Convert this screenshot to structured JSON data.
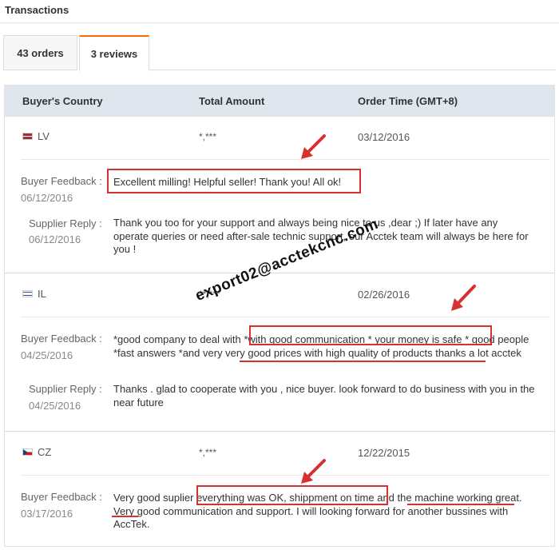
{
  "section_title": "Transactions",
  "tabs": [
    {
      "label": "43 orders"
    },
    {
      "label": "3 reviews"
    }
  ],
  "columns": {
    "country": "Buyer's Country",
    "amount": "Total Amount",
    "time": "Order Time (GMT+8)"
  },
  "labels": {
    "buyer_feedback": "Buyer Feedback :",
    "supplier_reply": "Supplier Reply :"
  },
  "reviews": [
    {
      "country": "LV",
      "amount": "*,***",
      "order_time": "03/12/2016",
      "feedback_date": "06/12/2016",
      "feedback": "Excellent milling! Helpful seller! Thank you! All ok!",
      "reply_date": "06/12/2016",
      "reply": "Thank you too for your support and always being nice to us ,dear ;) If later have any operate queries or need after-sale technic support, our Acctek team will always be here for you !"
    },
    {
      "country": "IL",
      "amount": "**,***",
      "order_time": "02/26/2016",
      "feedback_date": "04/25/2016",
      "feedback": "*good company to deal with *with good communication * your money is safe * good people *fast answers *and very very good prices with high quality of products thanks a lot acctek",
      "reply_date": "04/25/2016",
      "reply": "Thanks . glad to cooperate with you , nice buyer. look forward to do business with you in the near future"
    },
    {
      "country": "CZ",
      "amount": "*,***",
      "order_time": "12/22/2015",
      "feedback_date": "03/17/2016",
      "feedback": "Very good suplier everything was OK, shippment on time and the machine working great. Very good communication and support. I will looking forward for another bussines with AccTek."
    }
  ],
  "watermark": "export02@acctekcnc.com",
  "colors": {
    "accent": "#ff6a00",
    "annotation": "#d63031",
    "header_bg": "#dfe6ee"
  },
  "icons": [
    "flag-latvia-icon",
    "flag-israel-icon",
    "flag-czech-icon",
    "red-arrow-icon"
  ]
}
